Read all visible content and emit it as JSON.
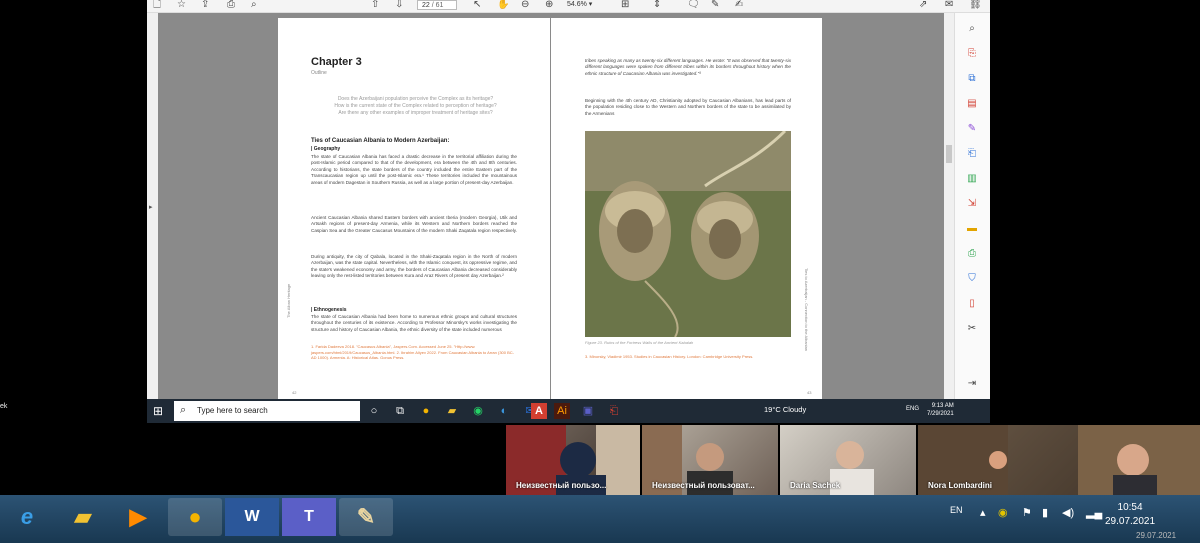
{
  "pdf_viewer": {
    "page_current": "22",
    "page_total": "/ 61",
    "zoom": "54.6%"
  },
  "left_page": {
    "chapter_title": "Chapter 3",
    "chapter_subtitle": "Outline",
    "questions": [
      "Does the Azerbaijani population perceive the Complex as its heritage?",
      "How is the current state of the Complex related to perception of heritage?",
      "Are there any other examples of improper treatment of heritage sites?"
    ],
    "section_heading": "Ties of Caucasian Albania to Modern Azerbaijan:",
    "section_sub": "| Geography",
    "para1": "The state of Caucasian Albania has faced a drastic decrease in the territorial affiliation during the post-Islamic period compared to that of the development, era between the 4th and 8th centuries. According to historians, the state borders of the country included the entire Eastern part of the Transcaucasian region up until the post-Islamic era.¹ These territories included the mountainous areas of modern Dagestan in Southern Russia, as well as a large portion of present-day Azerbaijan.",
    "para2": "Ancient Caucasian Albania shared Eastern borders with ancient Iberia (modern Georgia), Utik and Artsakh regions of present-day Armenia, while its Western and Northern borders reached the Caspian Sea and the Greater Caucasus Mountains of the modern Shaki Zaqatala region respectively.",
    "para3": "During antiquity, the city of Qabala, located in the Shaki-Zaqatala region in the North of modern Azerbaijan, was the state capital. Nevertheless, with the Islamic conquest, its oppressive regime, and the state's weakened economy and army, the borders of Caucasian Albania decreased considerably leaving only the rest-listed territories between Kura and Araz Rivers of present day Azerbaijan.²",
    "section2_sub": "| Ethnogenesis",
    "para4": "The state of Caucasian Albania had been home to numerous ethnic groups and cultural structures throughout the centuries of its existence. According to Professor Minorsky's works investigating the structure and history of Caucasian Albania, the ethnic diversity of the state included numerous",
    "footnotes": "1. Farida Dadeeva 2018. \"Caucasus Albania\", Jaspers.Com. Accessed June 25. \"Http://www. jaspers.com/html/2019/Caucasus_Albania.html. 2. Ibrahim Aliyev 2022. From Caucasian Albania to Arran (300 BC-AD 1000). Armenia. A: Historical Atlas. Gonus Press.",
    "vertical_text": "The Alban Heritage",
    "page_number": "42"
  },
  "right_page": {
    "para1": "tribes speaking as many as twenty-six different languages. He wrote: \"It was observed that twenty-six different languages were spoken from different tribes within its borders throughout history when the ethnic structure of Caucasian Albania was investigated.\"³",
    "para2": "Beginning with the 4th century AD, Christianity adopted by Caucasian Albanians, has lead parts of the population residing close to the Western and Northern borders of the state to be assimilated by the Armenians",
    "caption": "Figure 23. Ruins of the Fortress Walls of the Ancient Kabalah",
    "footnote": "3. Minorsky, Vladimir 1953. Studies in Caucasian History. London: Cambridge University Press.",
    "vertical_text": "Ties to Azerbaijan - Connection to the Albanian",
    "page_number": "43"
  },
  "remote_taskbar": {
    "search_placeholder": "Type here to search",
    "weather": "19°C  Cloudy",
    "lang": "ENG",
    "time": "9:13 AM",
    "date": "7/29/2021"
  },
  "meeting": {
    "left_label": "ek",
    "participants": [
      {
        "name": "Неизвестный пользо..."
      },
      {
        "name": "Неизвестный пользоват..."
      },
      {
        "name": "Daria Sachek"
      },
      {
        "name": "Nora Lombardini"
      }
    ]
  },
  "host_taskbar": {
    "lang": "EN",
    "time": "10:54",
    "date": "29.07.2021",
    "date_under": "29.07.2021"
  },
  "colors": {
    "accent_orange": "#e07a3e",
    "pdf_red": "#d23f31",
    "host_taskbar": "#234867"
  }
}
